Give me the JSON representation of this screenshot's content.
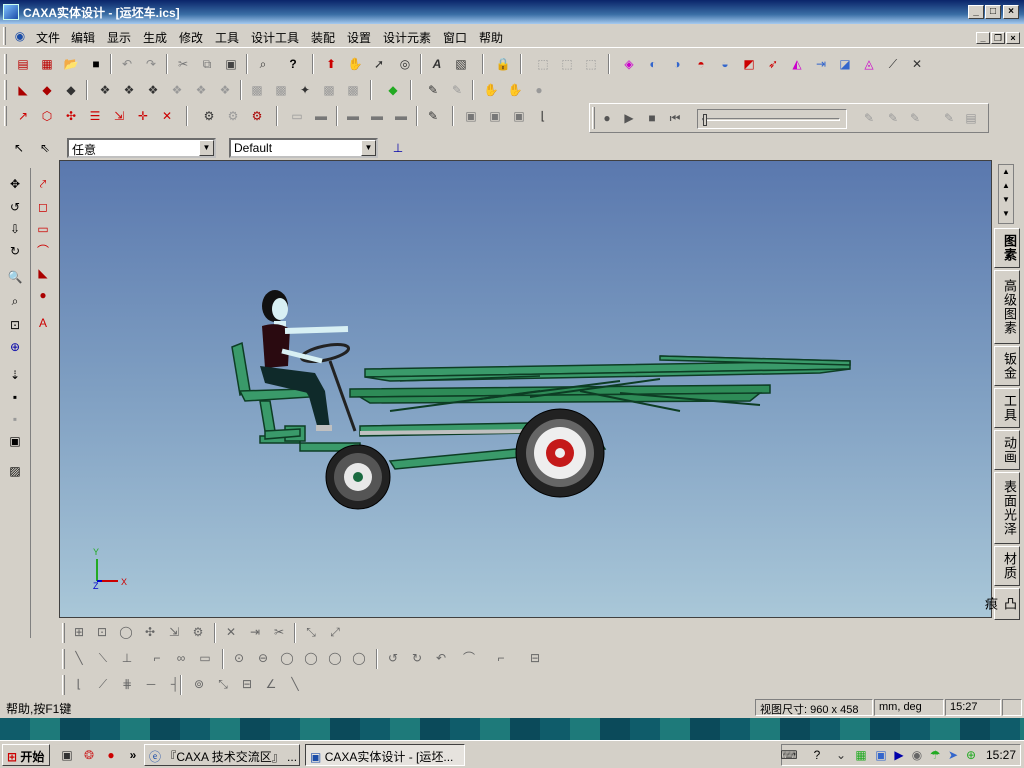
{
  "window": {
    "title": "CAXA实体设计 - [运坯车.ics]"
  },
  "menu": [
    "文件",
    "编辑",
    "显示",
    "生成",
    "修改",
    "工具",
    "设计工具",
    "装配",
    "设置",
    "设计元素",
    "窗口",
    "帮助"
  ],
  "selection": {
    "filter_value": "任意",
    "config_value": "Default"
  },
  "right_tabs": [
    "图素",
    "高级图素",
    "钣金",
    "工具",
    "动画",
    "表面光泽",
    "材质",
    "凸痕"
  ],
  "axes": {
    "y": "Y",
    "z": "Z",
    "x": "X"
  },
  "status": {
    "help": "帮助,按F1键",
    "view_size_label": "视图尺寸:",
    "view_size_value": "960 x 458",
    "units": "mm, deg",
    "time": "15:27"
  },
  "taskbar": {
    "start": "开始",
    "task1": "『CAXA 技术交流区』 ...",
    "task2": "CAXA实体设计 - [运坯...",
    "clock": "15:27"
  },
  "colors": {
    "title_start": "#0a246a",
    "title_end": "#a6caf0",
    "viewport_top": "#5a78ae",
    "viewport_bottom": "#a9c7d8",
    "frame_green": "#2e8b57"
  }
}
